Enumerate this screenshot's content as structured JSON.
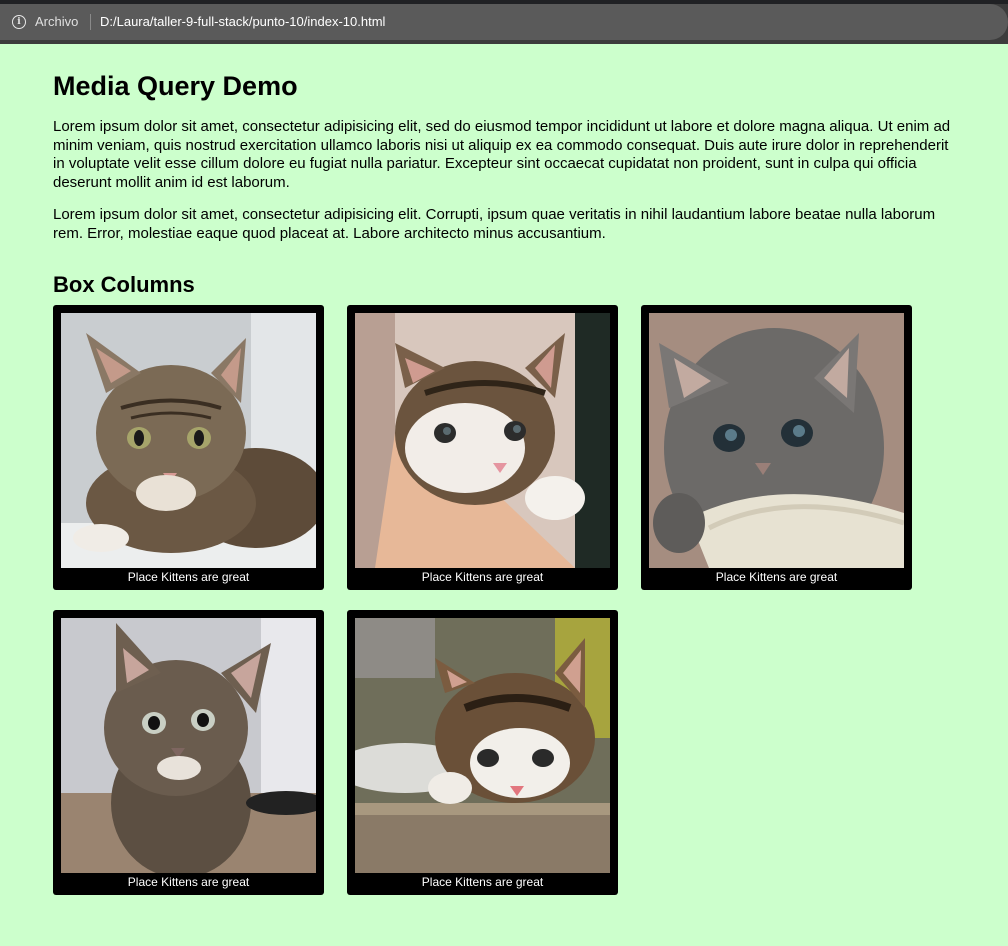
{
  "browser": {
    "security_label": "Archivo",
    "url": "D:/Laura/taller-9-full-stack/punto-10/index-10.html"
  },
  "page": {
    "title": "Media Query Demo",
    "paragraphs": [
      "Lorem ipsum dolor sit amet, consectetur adipisicing elit, sed do eiusmod tempor incididunt ut labore et dolore magna aliqua. Ut enim ad minim veniam, quis nostrud exercitation ullamco laboris nisi ut aliquip ex ea commodo consequat. Duis aute irure dolor in reprehenderit in voluptate velit esse cillum dolore eu fugiat nulla pariatur. Excepteur sint occaecat cupidatat non proident, sunt in culpa qui officia deserunt mollit anim id est laborum.",
      "Lorem ipsum dolor sit amet, consectetur adipisicing elit. Corrupti, ipsum quae veritatis in nihil laudantium labore beatae nulla laborum rem. Error, molestiae eaque quod placeat at. Labore architecto minus accusantium."
    ],
    "section_title": "Box Columns"
  },
  "cards": [
    {
      "caption": "Place Kittens are great",
      "image": "tabby-kitten-on-windowsill"
    },
    {
      "caption": "Place Kittens are great",
      "image": "kitten-held-in-hand"
    },
    {
      "caption": "Place Kittens are great",
      "image": "gray-kitten-with-blanket"
    },
    {
      "caption": "Place Kittens are great",
      "image": "fluffy-tabby-kitten"
    },
    {
      "caption": "Place Kittens are great",
      "image": "calico-kitten-on-ledge"
    }
  ],
  "colors": {
    "page_background": "#ccffcc",
    "card_background": "#000000",
    "caption_text": "#ffffff"
  }
}
